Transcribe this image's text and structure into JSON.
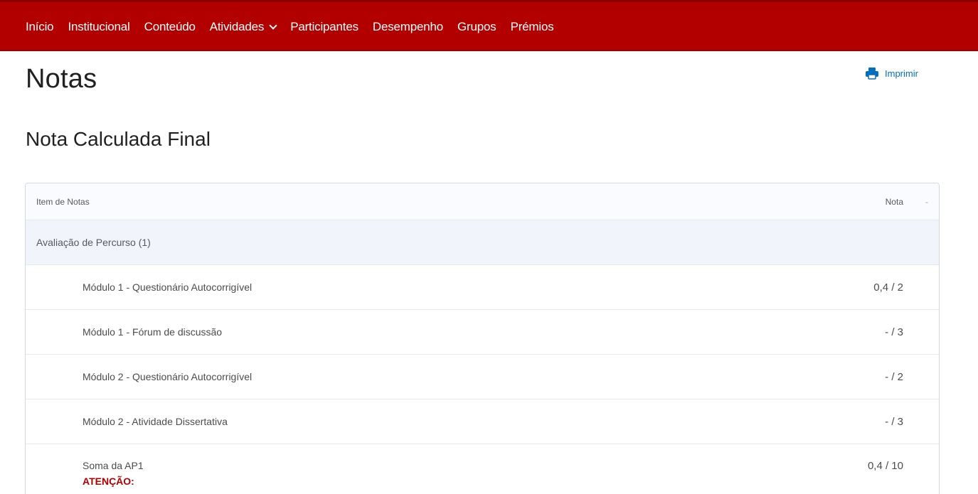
{
  "nav": {
    "items": [
      {
        "label": "Início"
      },
      {
        "label": "Institucional"
      },
      {
        "label": "Conteúdo"
      },
      {
        "label": "Atividades"
      },
      {
        "label": "Participantes"
      },
      {
        "label": "Desempenho"
      },
      {
        "label": "Grupos"
      },
      {
        "label": "Prémios"
      }
    ]
  },
  "header": {
    "title": "Notas",
    "print_label": "Imprimir"
  },
  "section": {
    "title": "Nota Calculada Final"
  },
  "table": {
    "columns": {
      "item": "Item de Notas",
      "grade": "Nota",
      "sort": "-"
    },
    "category": "Avaliação de Percurso (1)",
    "rows": [
      {
        "name": "Módulo 1 - Questionário Autocorrigível",
        "grade": "0,4 / 2"
      },
      {
        "name": "Módulo 1 - Fórum de discussão",
        "grade": "- / 3"
      },
      {
        "name": "Módulo 2 - Questionário Autocorrigível",
        "grade": "- / 2"
      },
      {
        "name": "Módulo 2 - Atividade Dissertativa",
        "grade": "- / 3"
      }
    ],
    "sum": {
      "name": "Soma da AP1",
      "warning": "ATENÇÃO:",
      "grade": "0,4 / 10"
    }
  },
  "colors": {
    "topbar": "#b20000",
    "link": "#006fbf",
    "warning": "#b20000"
  }
}
